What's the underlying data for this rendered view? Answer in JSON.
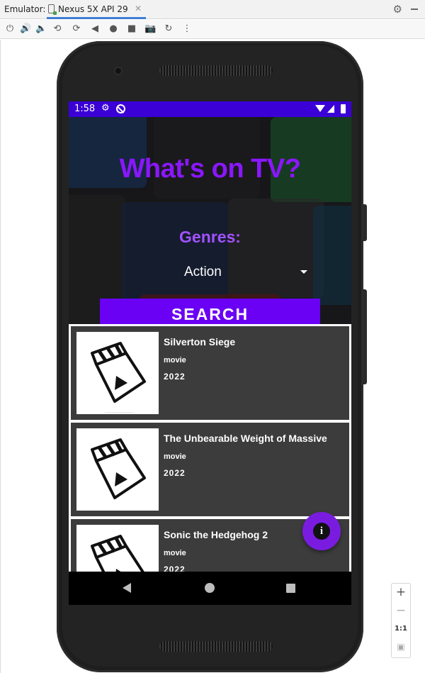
{
  "emulator": {
    "label": "Emulator:",
    "device_tab": "Nexus 5X API 29",
    "toolbar_icons": [
      "power-icon",
      "volume-up-icon",
      "volume-down-icon",
      "rotate-left-icon",
      "rotate-right-icon",
      "back-icon",
      "home-icon",
      "overview-icon",
      "screenshot-icon",
      "snapshot-icon",
      "more-icon"
    ],
    "zoom": {
      "plus": "+",
      "minus": "−",
      "one_to_one": "1:1"
    }
  },
  "status_bar": {
    "time": "1:58",
    "color": "#3a00d6"
  },
  "hero": {
    "title": "What's on TV?",
    "genres_label": "Genres:",
    "selected_genre": "Action",
    "search_label": "SEARCH",
    "title_color": "#8a17ff",
    "button_color": "#6a00f4"
  },
  "results": [
    {
      "title": "Silverton Siege",
      "type": "movie",
      "year": "2022"
    },
    {
      "title": "The Unbearable Weight of Massive",
      "type": "movie",
      "year": "2022"
    },
    {
      "title": "Sonic the Hedgehog 2",
      "type": "movie",
      "year": "2022"
    }
  ],
  "fab": {
    "icon": "i"
  }
}
